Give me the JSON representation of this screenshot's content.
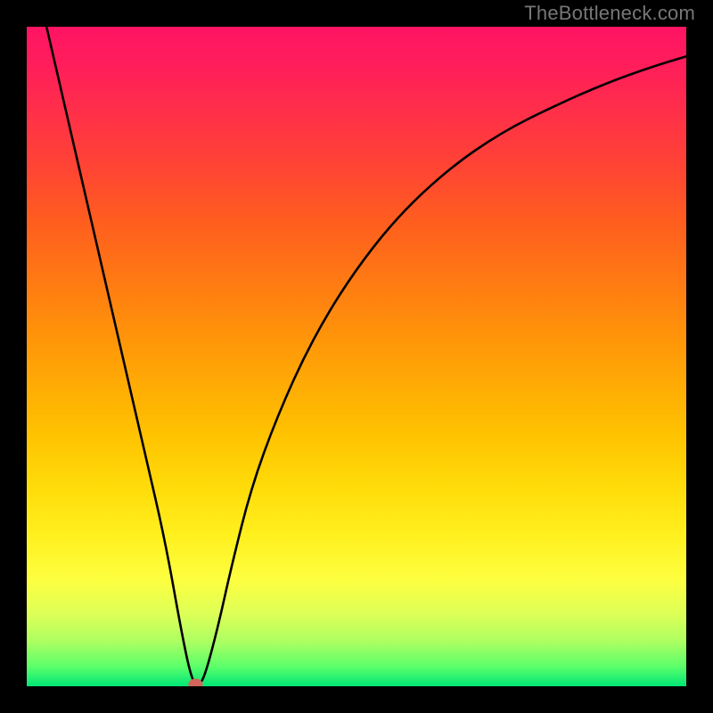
{
  "watermark": "TheBottleneck.com",
  "chart_data": {
    "type": "line",
    "title": "",
    "xlabel": "",
    "ylabel": "",
    "xlim": [
      0,
      100
    ],
    "ylim": [
      0,
      100
    ],
    "grid": false,
    "series": [
      {
        "name": "curve",
        "x": [
          3,
          6,
          9,
          12,
          15,
          18,
          21,
          23.5,
          25,
          26,
          27,
          29,
          31,
          34,
          38,
          43,
          49,
          56,
          64,
          72,
          80,
          88,
          95,
          100
        ],
        "values": [
          100,
          87,
          74,
          61,
          48,
          35,
          22,
          8,
          1,
          0,
          1.5,
          9,
          18,
          30,
          41,
          52,
          62,
          71,
          78.5,
          84,
          88,
          91.5,
          94,
          95.5
        ]
      }
    ],
    "marker": {
      "x": 25.6,
      "y": 0.3
    },
    "background_gradient": {
      "direction": "top-to-bottom",
      "stops": [
        {
          "pos": 0,
          "color": "#ff1464"
        },
        {
          "pos": 14,
          "color": "#ff3246"
        },
        {
          "pos": 30,
          "color": "#ff5f1e"
        },
        {
          "pos": 46,
          "color": "#ff910a"
        },
        {
          "pos": 62,
          "color": "#ffc300"
        },
        {
          "pos": 77,
          "color": "#fff01e"
        },
        {
          "pos": 89,
          "color": "#ddff57"
        },
        {
          "pos": 100,
          "color": "#00e676"
        }
      ]
    }
  }
}
